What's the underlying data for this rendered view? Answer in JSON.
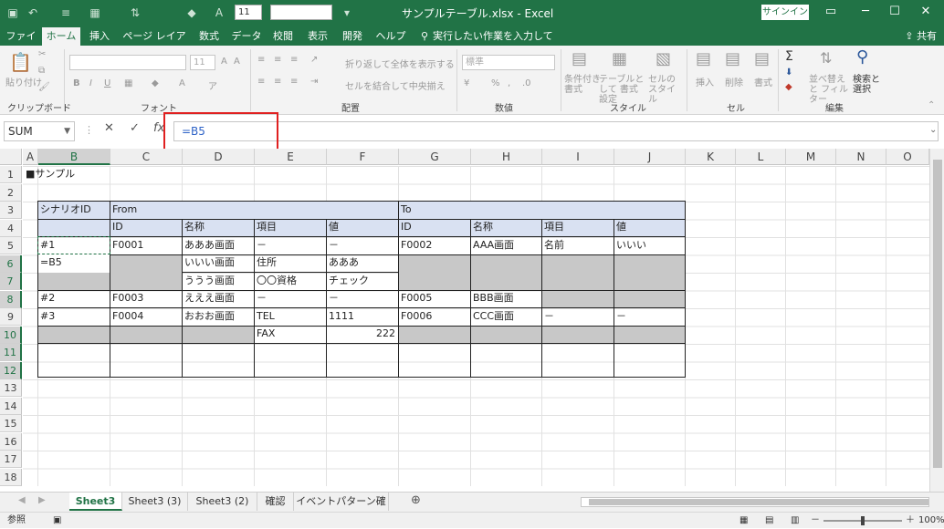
{
  "window": {
    "title": "サンプルテーブル.xlsx - Excel",
    "signin": "サインイン",
    "font_size_qat": "11"
  },
  "tabs": [
    "ファイル",
    "ホーム",
    "挿入",
    "ページ レイアウト",
    "数式",
    "データ",
    "校閲",
    "表示",
    "開発",
    "ヘルプ"
  ],
  "search_placeholder": "実行したい作業を入力してください",
  "share": "共有",
  "ribbon": {
    "paste": "貼り付け",
    "clipboard": "クリップボード",
    "font": "フォント",
    "font_size": "11",
    "bold": "B",
    "italic": "I",
    "underline": "U",
    "alignment": "配置",
    "wrap": "折り返して全体を表示する",
    "merge": "セルを結合して中央揃え",
    "number_format": "標準",
    "number": "数値",
    "cond_format": "条件付き 書式",
    "table_format": "テーブルとして 書式設定",
    "cell_style": "セルの スタイル",
    "style": "スタイル",
    "insert": "挿入",
    "delete": "削除",
    "format": "書式",
    "cells": "セル",
    "sort": "並べ替えと フィルター",
    "find": "検索と 選択",
    "editing": "編集"
  },
  "formula_bar": {
    "name_box": "SUM",
    "formula": "=B5"
  },
  "columns": [
    "A",
    "B",
    "C",
    "D",
    "E",
    "F",
    "G",
    "H",
    "I",
    "J",
    "K",
    "L",
    "M",
    "N",
    "O"
  ],
  "rows": [
    "1",
    "2",
    "3",
    "4",
    "5",
    "6",
    "7",
    "8",
    "9",
    "10",
    "11",
    "12",
    "13",
    "14",
    "15",
    "16",
    "17",
    "18"
  ],
  "cells": {
    "a1": "■サンプル",
    "b3": "シナリオID",
    "c3": "From",
    "g3": "To",
    "c4": "ID",
    "d4": "名称",
    "e4": "項目",
    "f4": "値",
    "g4": "ID",
    "h4": "名称",
    "i4": "項目",
    "j4": "値",
    "b5": "#1",
    "c5": "F0001",
    "d5": "あああ画面",
    "e5": "－",
    "f5": "－",
    "g5": "F0002",
    "h5": "AAA画面",
    "i5": "名前",
    "j5": "いいい",
    "b6": "=B5",
    "d6": "いいい画面",
    "e6": "住所",
    "f6": "あああ",
    "d7": "ううう画面",
    "e7": "〇〇資格",
    "f7": "チェック",
    "b8": "#2",
    "c8": "F0003",
    "d8": "えええ画面",
    "e8": "－",
    "f8": "－",
    "g8": "F0005",
    "h8": "BBB画面",
    "b9": "#3",
    "c9": "F0004",
    "d9": "おおお画面",
    "e9": "TEL",
    "f9": "1111",
    "g9": "F0006",
    "h9": "CCC画面",
    "i9": "－",
    "j9": "－",
    "e10": "FAX",
    "f10": "222"
  },
  "sheets": [
    "Sheet3",
    "Sheet3 (3)",
    "Sheet3 (2)",
    "確認",
    "イベントパターン確認"
  ],
  "status": {
    "mode": "参照",
    "zoom": "100%"
  }
}
